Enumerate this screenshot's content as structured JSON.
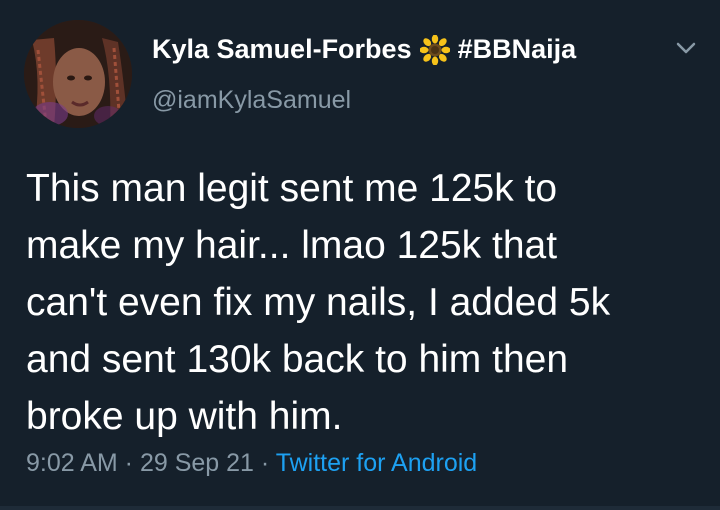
{
  "tweet": {
    "author": {
      "display_name": "Kyla Samuel-Forbes",
      "badge_icon": "sunflower-icon",
      "hashtag": "#BBNaija",
      "handle": "@iamKylaSamuel"
    },
    "text_lines": [
      "This man legit sent me 125k to",
      "make my hair... lmao 125k that",
      "can't even fix my nails, I added 5k",
      "and sent 130k back to him then",
      "broke up with him."
    ],
    "time": "9:02 AM",
    "separator": " · ",
    "date": "29 Sep 21",
    "source": "Twitter for Android"
  },
  "colors": {
    "background": "#15202b",
    "primary_text": "#ffffff",
    "secondary_text": "#8899a6",
    "link": "#1da1f2"
  }
}
